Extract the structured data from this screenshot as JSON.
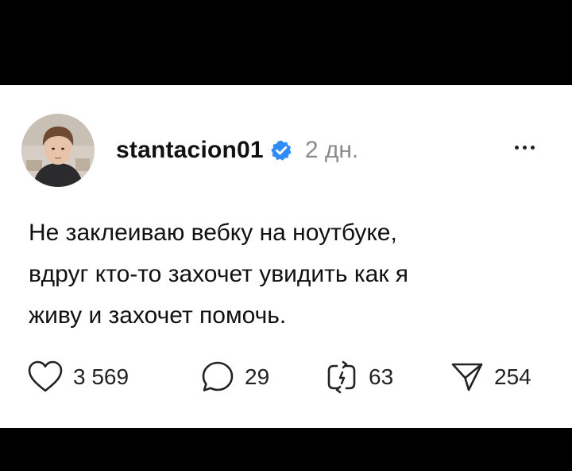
{
  "post": {
    "username": "stantacion01",
    "verified_icon": "verified-badge-icon",
    "timestamp": "2 дн.",
    "text": "Не заклеиваю вебку на ноутбуке,\nвдруг кто-то захочет увидить как я\nживу и захочет помочь."
  },
  "actions": {
    "like": {
      "icon": "heart-icon",
      "count": "3 569"
    },
    "comment": {
      "icon": "comment-icon",
      "count": "29"
    },
    "repost": {
      "icon": "repost-icon",
      "count": "63"
    },
    "share": {
      "icon": "send-icon",
      "count": "254"
    }
  },
  "colors": {
    "background": "#ffffff",
    "letterbox": "#000000",
    "text": "#111111",
    "muted": "#8a8a8a",
    "verified": "#2f8bf5"
  }
}
